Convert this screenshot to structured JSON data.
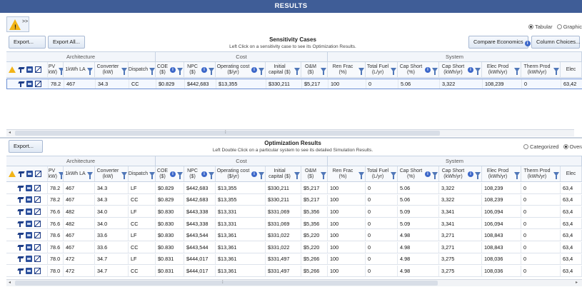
{
  "window": {
    "title": "RESULTS"
  },
  "view_toggle": {
    "tabular": "Tabular",
    "graphical": "Graphic"
  },
  "sensitivity": {
    "export_label": "Export...",
    "export_all_label": "Export All...",
    "title": "Sensitivity Cases",
    "subtitle": "Left Click on a sensitivity case to see its Optimization Results.",
    "compare_label": "Compare Economics",
    "column_choices_label": "Column Choices...",
    "groups": [
      "Architecture",
      "Cost",
      "System"
    ],
    "headers": [
      "PV (kW)",
      "1kWh LA",
      "Converter (kW)",
      "Dispatch",
      "COE ($)",
      "NPC ($)",
      "Operating cost ($/yr)",
      "Initial capital ($)",
      "O&M ($)",
      "Ren Frac (%)",
      "Total Fuel (L/yr)",
      "Cap Short (%)",
      "Cap Short (kWh/yr)",
      "Elec Prod (kWh/yr)",
      "Therm Prod (kWh/yr)",
      "Elec"
    ],
    "rows": [
      [
        "78.2",
        "467",
        "34.3",
        "CC",
        "$0.829",
        "$442,683",
        "$13,355",
        "$330,211",
        "$5,217",
        "100",
        "0",
        "5.06",
        "3,322",
        "108,239",
        "0",
        "63,42"
      ]
    ]
  },
  "optimization": {
    "export_label": "Export...",
    "title": "Optimization Results",
    "subtitle": "Left Double Click on a particular system to see its detailed Simulation Results.",
    "categorized": "Categorized",
    "overall": "Overa",
    "groups": [
      "Architecture",
      "Cost",
      "System"
    ],
    "headers": [
      "PV (kW)",
      "1kWh LA",
      "Converter (kW)",
      "Dispatch",
      "COE ($)",
      "NPC ($)",
      "Operating cost ($/yr)",
      "Initial capital ($)",
      "O&M ($)",
      "Ren Frac (%)",
      "Total Fuel (L/yr)",
      "Cap Short (%)",
      "Cap Short (kWh/yr)",
      "Elec Prod (kWh/yr)",
      "Therm Prod (kWh/yr)",
      "Elec"
    ],
    "rows": [
      [
        "78.2",
        "467",
        "34.3",
        "LF",
        "$0.829",
        "$442,683",
        "$13,355",
        "$330,211",
        "$5,217",
        "100",
        "0",
        "5.06",
        "3,322",
        "108,239",
        "0",
        "63,4"
      ],
      [
        "78.2",
        "467",
        "34.3",
        "CC",
        "$0.829",
        "$442,683",
        "$13,355",
        "$330,211",
        "$5,217",
        "100",
        "0",
        "5.06",
        "3,322",
        "108,239",
        "0",
        "63,4"
      ],
      [
        "76.6",
        "482",
        "34.0",
        "LF",
        "$0.830",
        "$443,338",
        "$13,331",
        "$331,069",
        "$5,356",
        "100",
        "0",
        "5.09",
        "3,341",
        "106,094",
        "0",
        "63,4"
      ],
      [
        "76.6",
        "482",
        "34.0",
        "CC",
        "$0.830",
        "$443,338",
        "$13,331",
        "$331,069",
        "$5,356",
        "100",
        "0",
        "5.09",
        "3,341",
        "106,094",
        "0",
        "63,4"
      ],
      [
        "78.6",
        "467",
        "33.6",
        "LF",
        "$0.830",
        "$443,544",
        "$13,361",
        "$331,022",
        "$5,220",
        "100",
        "0",
        "4.98",
        "3,271",
        "108,843",
        "0",
        "63,4"
      ],
      [
        "78.6",
        "467",
        "33.6",
        "CC",
        "$0.830",
        "$443,544",
        "$13,361",
        "$331,022",
        "$5,220",
        "100",
        "0",
        "4.98",
        "3,271",
        "108,843",
        "0",
        "63,4"
      ],
      [
        "78.0",
        "472",
        "34.7",
        "LF",
        "$0.831",
        "$444,017",
        "$13,361",
        "$331,497",
        "$5,266",
        "100",
        "0",
        "4.98",
        "3,275",
        "108,036",
        "0",
        "63,4"
      ],
      [
        "78.0",
        "472",
        "34.7",
        "CC",
        "$0.831",
        "$444,017",
        "$13,361",
        "$331,497",
        "$5,266",
        "100",
        "0",
        "4.98",
        "3,275",
        "108,036",
        "0",
        "63,4"
      ]
    ]
  },
  "colors": {
    "title_bar": "#3f5d97",
    "warning": "#f2b417",
    "accent": "#3c67c9"
  },
  "icons": [
    "warning-icon",
    "wind-turbine-icon",
    "battery-icon",
    "converter-icon",
    "filter-icon",
    "info-icon"
  ]
}
